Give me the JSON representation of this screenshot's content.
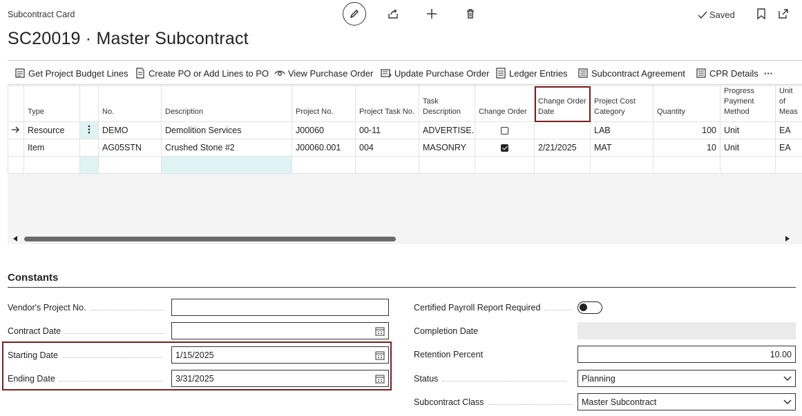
{
  "header": {
    "caption": "Subcontract Card",
    "title": "SC20019 · Master Subcontract",
    "saved_label": "Saved"
  },
  "actions": [
    {
      "label": "Get Project Budget Lines",
      "icon": "budget-lines-icon"
    },
    {
      "label": "Create PO or Add Lines to PO",
      "icon": "create-po-icon"
    },
    {
      "label": "View Purchase Order",
      "icon": "view-eye-icon"
    },
    {
      "label": "Update Purchase Order",
      "icon": "update-order-icon"
    },
    {
      "label": "Ledger Entries",
      "icon": "ledger-icon"
    },
    {
      "label": "Subcontract Agreement",
      "icon": "agreement-icon"
    },
    {
      "label": "CPR Details",
      "icon": "cpr-icon"
    },
    {
      "label": "···",
      "icon": "more-icon"
    }
  ],
  "lines": {
    "columns": [
      "Type",
      "No.",
      "Description",
      "Project No.",
      "Project Task No.",
      "Task Description",
      "Change Order",
      "Change Order Date",
      "Project Cost Category",
      "Quantity",
      "Progress Payment Method",
      "Unit of Meas"
    ],
    "rows": [
      {
        "type": "Resource",
        "no": "DEMO",
        "description": "Demolition Services",
        "project_no": "J00060",
        "task_no": "00-11",
        "task_description": "ADVERTISE...",
        "change_order": false,
        "change_order_date": "",
        "cost_category": "LAB",
        "quantity": "100",
        "payment_method": "Unit",
        "uom": "EA"
      },
      {
        "type": "Item",
        "no": "AG05STN",
        "description": "Crushed Stone #2",
        "project_no": "J00060.001",
        "task_no": "004",
        "task_description": "MASONRY",
        "change_order": true,
        "change_order_date": "2/21/2025",
        "cost_category": "MAT",
        "quantity": "10",
        "payment_method": "Unit",
        "uom": "EA"
      }
    ]
  },
  "constants": {
    "title": "Constants",
    "vendor_project_no": {
      "label": "Vendor's Project No.",
      "value": ""
    },
    "contract_date": {
      "label": "Contract Date",
      "value": ""
    },
    "starting_date": {
      "label": "Starting Date",
      "value": "1/15/2025"
    },
    "ending_date": {
      "label": "Ending Date",
      "value": "3/31/2025"
    },
    "cpr_required": {
      "label": "Certified Payroll Report Required",
      "value": false
    },
    "completion_date": {
      "label": "Completion Date",
      "value": ""
    },
    "retention_percent": {
      "label": "Retention Percent",
      "value": "10.00"
    },
    "status": {
      "label": "Status",
      "value": "Planning"
    },
    "subcontract_class": {
      "label": "Subcontract Class",
      "value": "Master Subcontract"
    }
  },
  "colors": {
    "highlight": "#7a1e1e",
    "selected_cell": "#dff3f5"
  }
}
